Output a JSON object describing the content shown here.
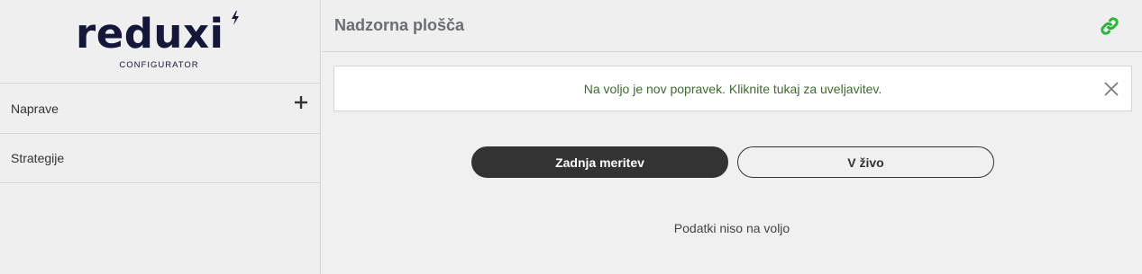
{
  "logo": {
    "brand": "reduxi",
    "subtitle": "CONFIGURATOR",
    "color": "#14163a"
  },
  "sidebar": {
    "items": [
      {
        "label": "Naprave",
        "icon": "plus-icon"
      },
      {
        "label": "Strategije"
      }
    ]
  },
  "header": {
    "title": "Nadzorna plošča",
    "status_icon": "link-icon",
    "status_color": "#27b83a"
  },
  "notice": {
    "text": "Na voljo je nov popravek. Kliknite tukaj za uveljavitev.",
    "close_icon": "close-icon"
  },
  "tabs": {
    "active_label": "Zadnja meritev",
    "inactive_label": "V živo"
  },
  "main": {
    "empty_text": "Podatki niso na voljo"
  }
}
